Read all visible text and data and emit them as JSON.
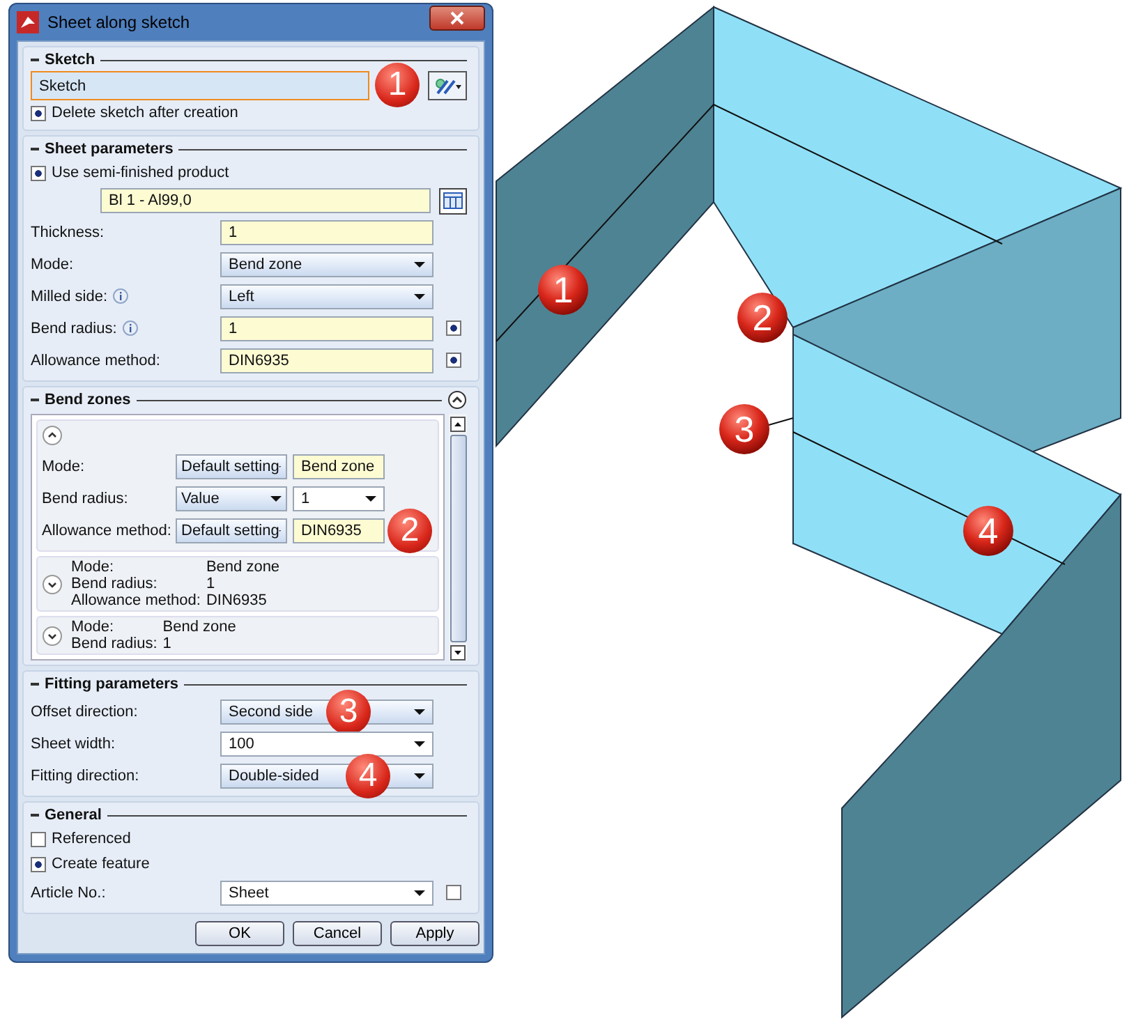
{
  "window": {
    "title": "Sheet along sketch"
  },
  "sketch": {
    "title": "Sketch",
    "field": {
      "value": "Sketch",
      "callout": "1"
    },
    "delete_after": {
      "label": "Delete sketch after creation",
      "checked": true
    }
  },
  "sheet_parameters": {
    "title": "Sheet parameters",
    "use_semi": {
      "label": "Use semi-finished product",
      "checked": true
    },
    "product": "Bl 1 - Al99,0",
    "rows": [
      {
        "label": "Thickness:",
        "kind": "field",
        "value": "1"
      },
      {
        "label": "Mode:",
        "kind": "dropdown",
        "value": "Bend zone"
      },
      {
        "label": "Milled side:",
        "info": true,
        "kind": "dropdown",
        "value": "Left"
      },
      {
        "label": "Bend radius:",
        "info": true,
        "kind": "field",
        "value": "1",
        "checked": true
      },
      {
        "label": "Allowance method:",
        "kind": "field",
        "value": "DIN6935",
        "checked": true
      }
    ]
  },
  "bend_zones": {
    "title": "Bend zones",
    "expanded_zone": {
      "rows": [
        {
          "label": "Mode:",
          "setting": "Default setting",
          "kind": "field",
          "value": "Bend zone"
        },
        {
          "label": "Bend radius:",
          "setting": "Value",
          "kind": "combo",
          "value": "1"
        },
        {
          "label": "Allowance method:",
          "setting": "Default setting",
          "kind": "field",
          "value": "DIN6935",
          "callout": "2"
        }
      ]
    },
    "collapsed_zones": [
      {
        "rows": [
          {
            "label": "Mode:",
            "value": "Bend zone"
          },
          {
            "label": "Bend radius:",
            "value": "1"
          },
          {
            "label": "Allowance method:",
            "value": "DIN6935"
          }
        ]
      },
      {
        "rows": [
          {
            "label": "Mode:",
            "value": "Bend zone"
          },
          {
            "label": "Bend radius:",
            "value": "1"
          }
        ]
      }
    ]
  },
  "fitting_parameters": {
    "title": "Fitting parameters",
    "rows": [
      {
        "label": "Offset direction:",
        "kind": "dropdown",
        "value": "Second side",
        "callout": "3"
      },
      {
        "label": "Sheet width:",
        "kind": "combo",
        "value": "100"
      },
      {
        "label": "Fitting direction:",
        "kind": "dropdown",
        "value": "Double-sided",
        "callout": "4"
      }
    ]
  },
  "general": {
    "title": "General",
    "referenced": {
      "label": "Referenced",
      "checked": false
    },
    "create_feature": {
      "label": "Create feature",
      "checked": true
    },
    "article": {
      "label": "Article No.:",
      "value": "Sheet",
      "checked": false
    }
  },
  "buttons": [
    "OK",
    "Cancel",
    "Apply"
  ],
  "diagram_callouts": [
    "1",
    "2",
    "3",
    "4"
  ]
}
